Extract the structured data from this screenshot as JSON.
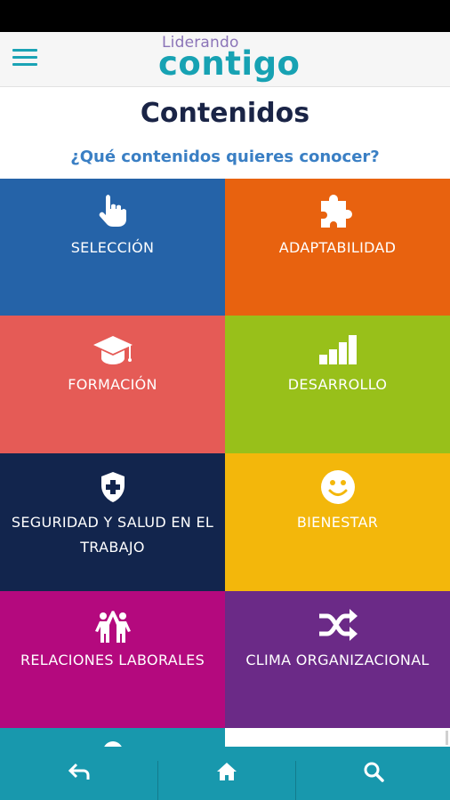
{
  "header": {
    "logo_top": "Liderando",
    "logo_main": "contigo"
  },
  "main": {
    "title": "Contenidos",
    "subtitle": "¿Qué contenidos quieres conocer?"
  },
  "tiles": [
    {
      "label": "SELECCIÓN",
      "color": "#2563a8",
      "icon": "pointing-hand-icon"
    },
    {
      "label": "ADAPTABILIDAD",
      "color": "#e8620f",
      "icon": "puzzle-piece-icon"
    },
    {
      "label": "FORMACIÓN",
      "color": "#e55b56",
      "icon": "graduation-cap-icon"
    },
    {
      "label": "DESARROLLO",
      "color": "#98c01a",
      "icon": "bar-chart-icon"
    },
    {
      "label": "SEGURIDAD Y SALUD EN EL TRABAJO",
      "color": "#12254d",
      "icon": "shield-cross-icon"
    },
    {
      "label": "BIENESTAR",
      "color": "#f3b70b",
      "icon": "smiley-icon"
    },
    {
      "label": "RELACIONES LABORALES",
      "color": "#b4097e",
      "icon": "people-high-five-icon"
    },
    {
      "label": "CLIMA ORGANIZACIONAL",
      "color": "#6b2a87",
      "icon": "shuffle-icon"
    }
  ],
  "partial_tiles": [
    {
      "color": "#1898ad",
      "icon": "globe-icon"
    },
    {
      "color": "#ffffff"
    }
  ],
  "navbar": {
    "items": [
      {
        "icon": "back-icon"
      },
      {
        "icon": "home-icon"
      },
      {
        "icon": "search-icon"
      }
    ],
    "color": "#1898ad"
  }
}
